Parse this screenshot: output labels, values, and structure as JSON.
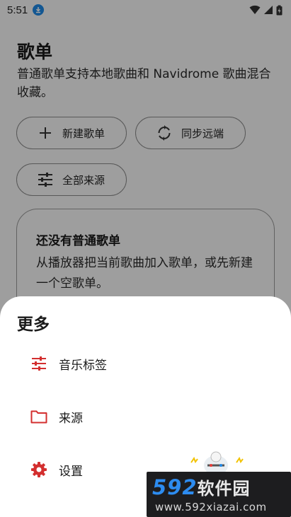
{
  "status_bar": {
    "time": "5:51"
  },
  "page": {
    "title": "歌单",
    "subtitle": "普通歌单支持本地歌曲和 Navidrome 歌曲混合收藏。",
    "buttons": {
      "new_playlist": "新建歌单",
      "sync_remote": "同步远端",
      "all_sources": "全部来源"
    },
    "empty_state": {
      "title": "还没有普通歌单",
      "text": "从播放器把当前歌曲加入歌单，或先新建一个空歌单。"
    }
  },
  "sheet": {
    "title": "更多",
    "items": [
      {
        "label": "音乐标签",
        "icon": "tune-icon"
      },
      {
        "label": "来源",
        "icon": "folder-icon"
      },
      {
        "label": "设置",
        "icon": "gear-icon"
      }
    ],
    "accent_color": "#d32f2f"
  },
  "watermark": {
    "logo_digits": "592",
    "logo_text": "软件园",
    "url": "www.592xiazai.com"
  }
}
